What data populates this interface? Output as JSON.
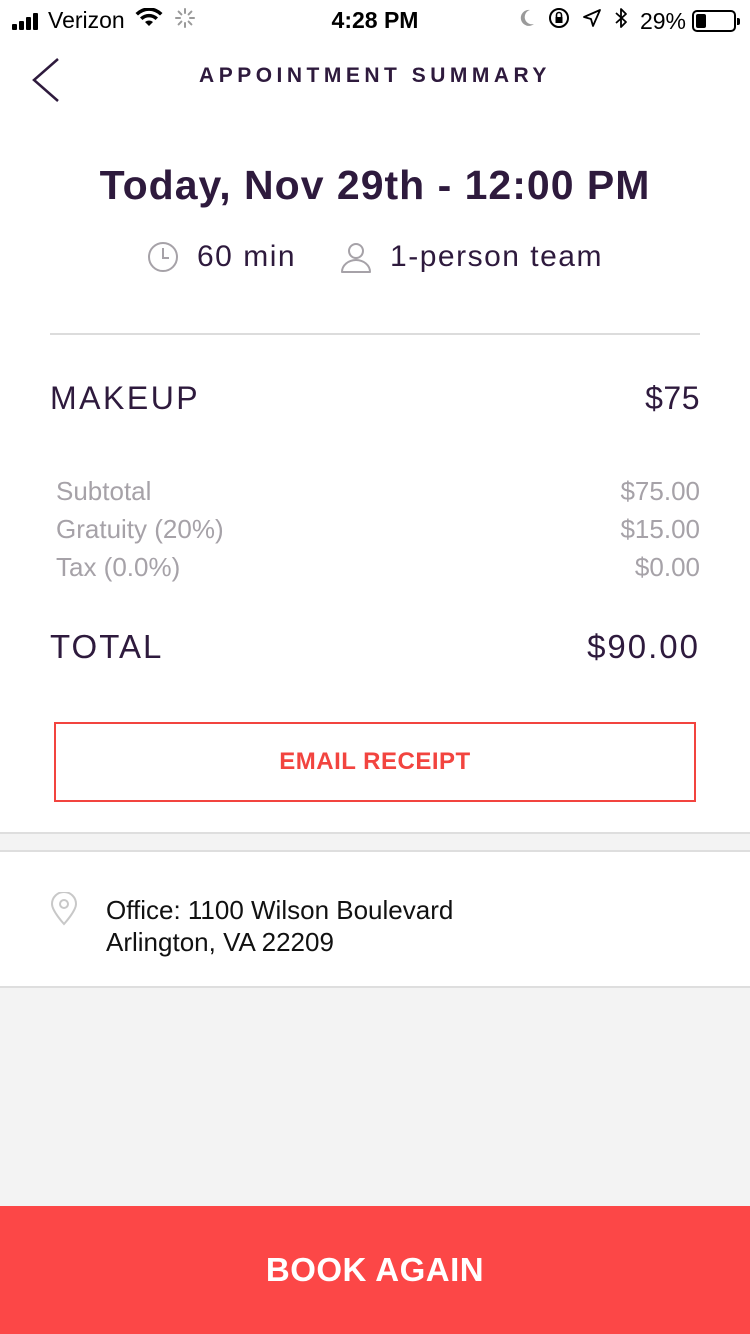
{
  "status_bar": {
    "carrier": "Verizon",
    "time": "4:28 PM",
    "battery_percent": "29%",
    "battery_level": 0.29,
    "icons": [
      "signal-icon",
      "wifi-icon",
      "activity-spinner-icon",
      "moon-icon",
      "rotation-lock-icon",
      "location-arrow-icon",
      "bluetooth-icon",
      "battery-icon"
    ]
  },
  "header": {
    "title": "APPOINTMENT SUMMARY",
    "back_icon": "chevron-left-icon"
  },
  "appointment": {
    "datetime": "Today, Nov 29th - 12:00 PM",
    "duration": "60 min",
    "duration_icon": "clock-icon",
    "team": "1-person team",
    "team_icon": "person-icon"
  },
  "service": {
    "name": "MAKEUP",
    "price": "$75"
  },
  "breakdown": [
    {
      "label": "Subtotal",
      "value": "$75.00"
    },
    {
      "label": "Gratuity (20%)",
      "value": "$15.00"
    },
    {
      "label": "Tax (0.0%)",
      "value": "$0.00"
    }
  ],
  "total": {
    "label": "TOTAL",
    "value": "$90.00"
  },
  "email_receipt_label": "EMAIL RECEIPT",
  "location": {
    "icon": "map-pin-icon",
    "line1": "Office: 1100 Wilson Boulevard",
    "line2": "Arlington, VA 22209"
  },
  "book_again_label": "BOOK AGAIN",
  "colors": {
    "primary_text": "#2e1a3d",
    "accent": "#fc4747",
    "muted_text": "#a6a2a8",
    "background_gray": "#f3f3f3"
  }
}
